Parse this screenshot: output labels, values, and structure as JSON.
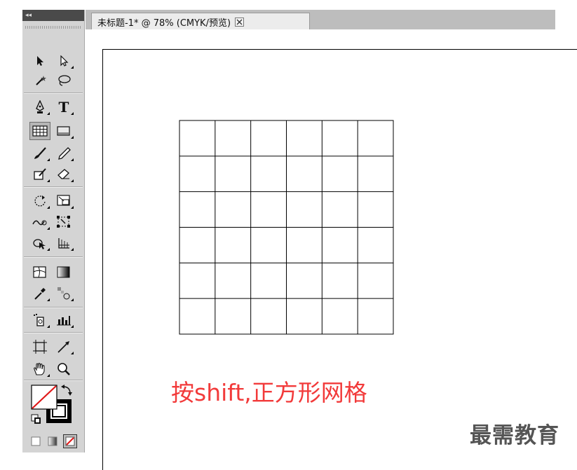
{
  "document_tab": {
    "title": "未标题-1* @ 78% (CMYK/预览)",
    "close_icon": "close-icon"
  },
  "toolbar": {
    "collapse_label": "◂◂",
    "tools": [
      {
        "name": "selection-tool",
        "icon": "arrow-icon"
      },
      {
        "name": "direct-selection-tool",
        "icon": "hollow-arrow-icon"
      },
      {
        "name": "magic-wand-tool",
        "icon": "magic-wand-icon"
      },
      {
        "name": "lasso-tool",
        "icon": "lasso-icon"
      },
      {
        "name": "pen-tool",
        "icon": "pen-icon"
      },
      {
        "name": "type-tool",
        "icon": "type-icon",
        "label": "T"
      },
      {
        "name": "rectangular-grid-tool",
        "icon": "grid-icon",
        "active": true
      },
      {
        "name": "rectangle-tool",
        "icon": "rectangle-icon"
      },
      {
        "name": "paintbrush-tool",
        "icon": "brush-icon"
      },
      {
        "name": "pencil-tool",
        "icon": "pencil-icon"
      },
      {
        "name": "blob-brush-tool",
        "icon": "blob-brush-icon"
      },
      {
        "name": "eraser-tool",
        "icon": "eraser-icon"
      },
      {
        "name": "rotate-tool",
        "icon": "rotate-icon"
      },
      {
        "name": "scale-tool",
        "icon": "scale-icon"
      },
      {
        "name": "warp-tool",
        "icon": "warp-icon"
      },
      {
        "name": "free-transform-tool",
        "icon": "free-transform-icon"
      },
      {
        "name": "shape-builder-tool",
        "icon": "shape-builder-icon"
      },
      {
        "name": "perspective-grid-tool",
        "icon": "perspective-grid-icon"
      },
      {
        "name": "mesh-tool",
        "icon": "mesh-icon"
      },
      {
        "name": "gradient-tool",
        "icon": "gradient-icon"
      },
      {
        "name": "eyedropper-tool",
        "icon": "eyedropper-icon"
      },
      {
        "name": "blend-tool",
        "icon": "blend-icon"
      },
      {
        "name": "symbol-sprayer-tool",
        "icon": "symbol-sprayer-icon"
      },
      {
        "name": "column-graph-tool",
        "icon": "column-graph-icon"
      },
      {
        "name": "artboard-tool",
        "icon": "artboard-icon"
      },
      {
        "name": "slice-tool",
        "icon": "slice-icon"
      },
      {
        "name": "hand-tool",
        "icon": "hand-icon"
      },
      {
        "name": "zoom-tool",
        "icon": "zoom-icon"
      }
    ],
    "fill_stroke": {
      "fill": "none",
      "stroke": "#000000",
      "swap_icon": "swap-arrow-icon",
      "default_icon": "default-colors-icon"
    },
    "color_modes": [
      "color-mode-icon",
      "gradient-mode-icon",
      "none-mode-icon"
    ]
  },
  "canvas": {
    "grid": {
      "rows": 6,
      "columns": 6,
      "stroke": "#000000"
    },
    "caption": "按shift,正方形网格",
    "caption_color": "#f23a3a"
  },
  "watermark": "最需教育",
  "colors": {
    "panel": "#d4d4d4",
    "tab_strip": "#bdbdbd",
    "accent_red": "#f23a3a"
  }
}
